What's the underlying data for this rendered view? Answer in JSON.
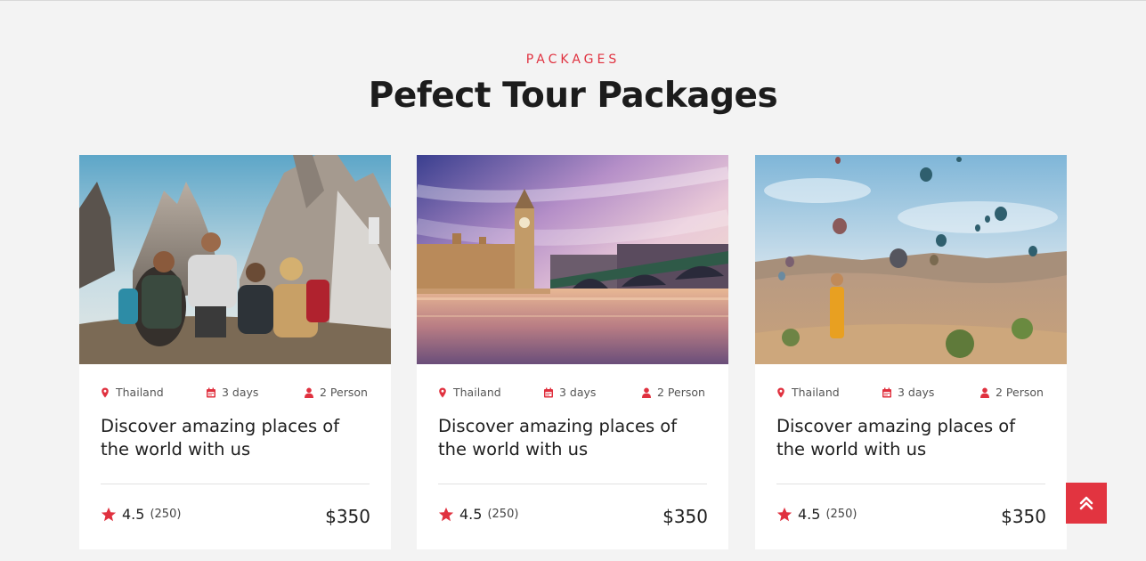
{
  "section": {
    "eyebrow": "PACKAGES",
    "title": "Pefect Tour Packages"
  },
  "colors": {
    "accent": "#e0313f",
    "background": "#f3f3f3",
    "card": "#ffffff"
  },
  "cards": [
    {
      "image": "hikers-in-mountains-photo",
      "location": "Thailand",
      "duration": "3 days",
      "people": "2 Person",
      "title": "Discover amazing places of the world with us",
      "rating": "4.5",
      "reviews": "(250)",
      "price": "$350"
    },
    {
      "image": "london-big-ben-bridge-photo",
      "location": "Thailand",
      "duration": "3 days",
      "people": "2 Person",
      "title": "Discover amazing places of the world with us",
      "rating": "4.5",
      "reviews": "(250)",
      "price": "$350"
    },
    {
      "image": "hot-air-balloons-valley-photo",
      "location": "Thailand",
      "duration": "3 days",
      "people": "2 Person",
      "title": "Discover amazing places of the world with us",
      "rating": "4.5",
      "reviews": "(250)",
      "price": "$350"
    }
  ],
  "icons": {
    "location": "map-pin-icon",
    "duration": "calendar-icon",
    "people": "user-icon",
    "rating": "star-icon",
    "scroll_top": "double-chevron-up-icon"
  }
}
